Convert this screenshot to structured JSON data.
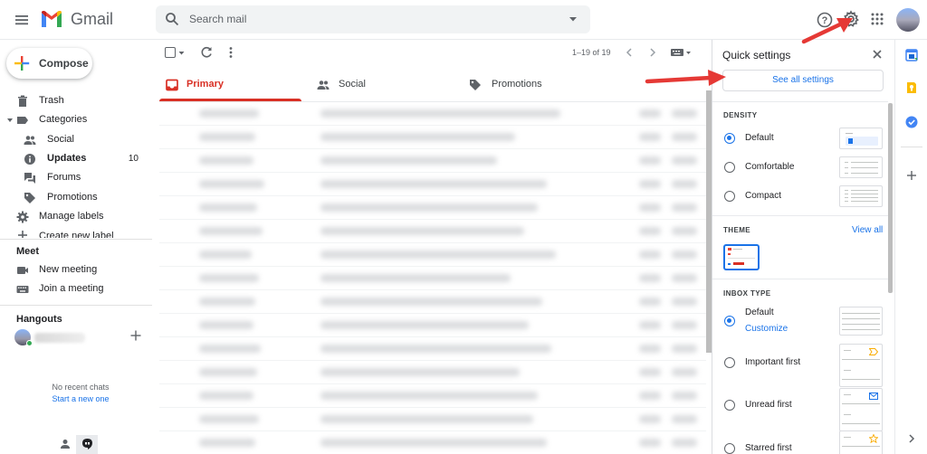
{
  "header": {
    "app_name": "Gmail",
    "search_placeholder": "Search mail",
    "icons": [
      "menu-icon",
      "gmail-logo",
      "search-icon",
      "search-options-icon",
      "help-icon",
      "gear-icon",
      "apps-icon",
      "account-avatar"
    ]
  },
  "sidebar": {
    "compose_label": "Compose",
    "items": [
      {
        "label": "Trash",
        "icon": "trash-icon",
        "count": ""
      },
      {
        "label": "Categories",
        "icon": "label-icon",
        "count": ""
      },
      {
        "label": "Social",
        "icon": "people-icon",
        "count": ""
      },
      {
        "label": "Updates",
        "icon": "info-icon",
        "count": "10"
      },
      {
        "label": "Forums",
        "icon": "forum-icon",
        "count": ""
      },
      {
        "label": "Promotions",
        "icon": "tag-icon",
        "count": ""
      },
      {
        "label": "Manage labels",
        "icon": "gear-icon",
        "count": ""
      },
      {
        "label": "Create new label",
        "icon": "plus-icon",
        "count": ""
      }
    ],
    "meet": {
      "heading": "Meet",
      "items": [
        {
          "label": "New meeting",
          "icon": "video-icon"
        },
        {
          "label": "Join a meeting",
          "icon": "keyboard-icon"
        }
      ]
    },
    "hangouts": {
      "heading": "Hangouts",
      "no_chats": "No recent chats",
      "start_chat": "Start a new one"
    }
  },
  "toolbar": {
    "range": "1–19 of 19"
  },
  "tabs": [
    {
      "label": "Primary",
      "icon": "inbox-icon",
      "active": true
    },
    {
      "label": "Social",
      "icon": "people-icon",
      "active": false
    },
    {
      "label": "Promotions",
      "icon": "tag-icon",
      "active": false
    }
  ],
  "quick_settings": {
    "title": "Quick settings",
    "see_all": "See all settings",
    "density": {
      "heading": "DENSITY",
      "options": [
        {
          "label": "Default",
          "selected": true
        },
        {
          "label": "Comfortable",
          "selected": false
        },
        {
          "label": "Compact",
          "selected": false
        }
      ]
    },
    "theme": {
      "heading": "THEME",
      "view_all": "View all"
    },
    "inbox_type": {
      "heading": "INBOX TYPE",
      "options": [
        {
          "label": "Default",
          "selected": true,
          "link": "Customize"
        },
        {
          "label": "Important first",
          "selected": false,
          "link": ""
        },
        {
          "label": "Unread first",
          "selected": false,
          "link": ""
        },
        {
          "label": "Starred first",
          "selected": false,
          "link": ""
        }
      ]
    }
  },
  "colors": {
    "accent_blue": "#1a73e8",
    "primary_red": "#d93025",
    "arrow_red": "#e53935"
  }
}
